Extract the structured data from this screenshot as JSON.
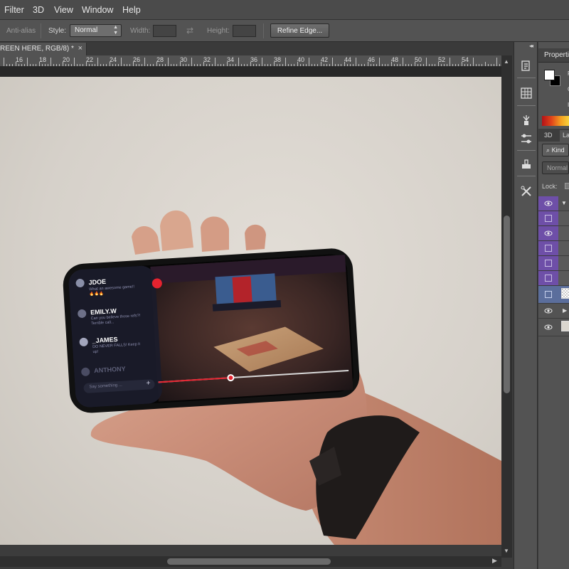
{
  "menubar": {
    "items": [
      "Filter",
      "3D",
      "View",
      "Window",
      "Help"
    ]
  },
  "options": {
    "anti_alias_label": "Anti-alias",
    "style_label": "Style:",
    "style_value": "Normal",
    "width_label": "Width:",
    "height_label": "Height:",
    "refine_edge_label": "Refine Edge..."
  },
  "document_tab": {
    "title": "REEN HERE, RGB/8) *",
    "close_glyph": "×"
  },
  "ruler": {
    "labels": [
      "16",
      "18",
      "20",
      "22",
      "24",
      "26",
      "28",
      "30",
      "32",
      "34",
      "36",
      "38",
      "40",
      "42",
      "44",
      "46",
      "48",
      "50",
      "52",
      "54"
    ]
  },
  "panels": {
    "properties_title": "Propertie",
    "tab_3d": "3D",
    "tab_layers": "La",
    "kind_filter": "Kind",
    "blend_mode": "Normal",
    "lock_label": "Lock:",
    "tiny_letters": [
      "P",
      "C",
      "I"
    ]
  },
  "phone_ui": {
    "chat": [
      {
        "name": "JDOE",
        "message": "What an awesome game!! 🔥🔥🔥"
      },
      {
        "name": "EMILY.W",
        "message": "Can you believe those refs?! Terrible call..."
      },
      {
        "name": "_JAMES",
        "message": "DO NEVER FALLS! Keep it up!"
      },
      {
        "name": "ANTHONY",
        "message": ""
      }
    ],
    "input_placeholder": "Say something ...",
    "send_glyph": "+",
    "live_dot_glyph": "◎",
    "video_progress": 0.38
  },
  "colors": {
    "app_bg": "#535353",
    "accent_purple": "#6e4fa8",
    "selected_layer": "#5b6e9c",
    "chat_red": "#e5232f"
  }
}
